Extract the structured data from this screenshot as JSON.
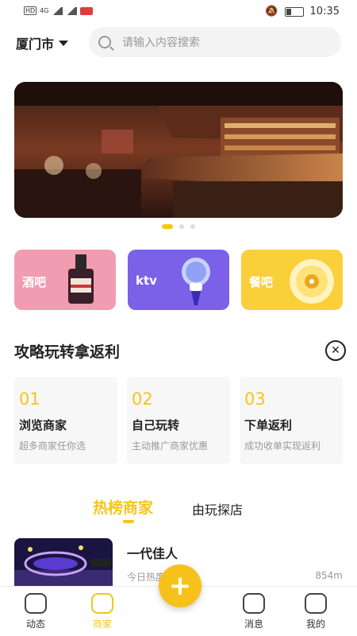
{
  "status_bar": {
    "time": "10:35",
    "hd": "HD",
    "network": "4G"
  },
  "header": {
    "city": "厦门市",
    "search_placeholder": "请输入内容搜索"
  },
  "banner": {
    "slide_count": 3,
    "active_index": 0
  },
  "categories": [
    {
      "label": "酒吧",
      "color": "#f19cb0",
      "icon": "bottle-icon"
    },
    {
      "label": "ktv",
      "color": "#7b61e8",
      "icon": "microphone-icon"
    },
    {
      "label": "餐吧",
      "color": "#f9cf3a",
      "icon": "record-icon"
    }
  ],
  "guide": {
    "title": "攻略玩转拿返利",
    "steps": [
      {
        "num": "01",
        "title": "浏览商家",
        "desc": "超多商家任你选"
      },
      {
        "num": "02",
        "title": "自己玩转",
        "desc": "主动推广商家优惠"
      },
      {
        "num": "03",
        "title": "下单返利",
        "desc": "成功收单实现返利"
      }
    ]
  },
  "tabs": {
    "hot": "热榜商家",
    "explore": "由玩探店"
  },
  "shop": {
    "name": "一代佳人",
    "hot_label": "今日热度",
    "distance": "854m"
  },
  "tabbar": [
    {
      "label": "动态",
      "icon": "planet-icon",
      "active": false
    },
    {
      "label": "商家",
      "icon": "shop-icon",
      "active": true
    },
    {
      "label": "消息",
      "icon": "message-icon",
      "active": false
    },
    {
      "label": "我的",
      "icon": "profile-icon",
      "active": false
    }
  ],
  "colors": {
    "accent": "#f5c518"
  }
}
